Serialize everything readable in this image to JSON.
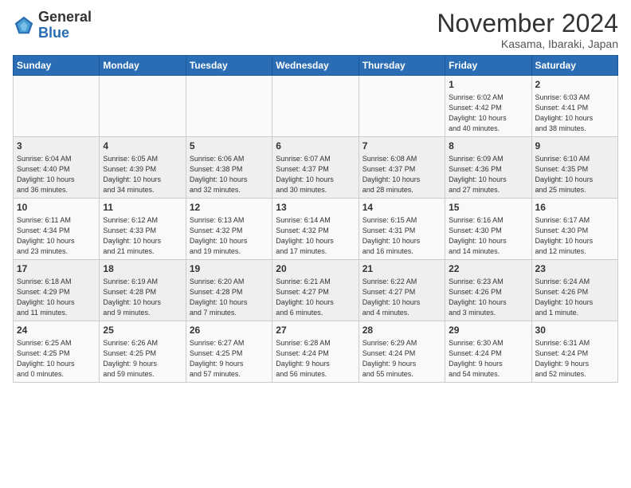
{
  "header": {
    "logo_general": "General",
    "logo_blue": "Blue",
    "month_title": "November 2024",
    "subtitle": "Kasama, Ibaraki, Japan"
  },
  "weekdays": [
    "Sunday",
    "Monday",
    "Tuesday",
    "Wednesday",
    "Thursday",
    "Friday",
    "Saturday"
  ],
  "weeks": [
    [
      {
        "day": "",
        "info": ""
      },
      {
        "day": "",
        "info": ""
      },
      {
        "day": "",
        "info": ""
      },
      {
        "day": "",
        "info": ""
      },
      {
        "day": "",
        "info": ""
      },
      {
        "day": "1",
        "info": "Sunrise: 6:02 AM\nSunset: 4:42 PM\nDaylight: 10 hours\nand 40 minutes."
      },
      {
        "day": "2",
        "info": "Sunrise: 6:03 AM\nSunset: 4:41 PM\nDaylight: 10 hours\nand 38 minutes."
      }
    ],
    [
      {
        "day": "3",
        "info": "Sunrise: 6:04 AM\nSunset: 4:40 PM\nDaylight: 10 hours\nand 36 minutes."
      },
      {
        "day": "4",
        "info": "Sunrise: 6:05 AM\nSunset: 4:39 PM\nDaylight: 10 hours\nand 34 minutes."
      },
      {
        "day": "5",
        "info": "Sunrise: 6:06 AM\nSunset: 4:38 PM\nDaylight: 10 hours\nand 32 minutes."
      },
      {
        "day": "6",
        "info": "Sunrise: 6:07 AM\nSunset: 4:37 PM\nDaylight: 10 hours\nand 30 minutes."
      },
      {
        "day": "7",
        "info": "Sunrise: 6:08 AM\nSunset: 4:37 PM\nDaylight: 10 hours\nand 28 minutes."
      },
      {
        "day": "8",
        "info": "Sunrise: 6:09 AM\nSunset: 4:36 PM\nDaylight: 10 hours\nand 27 minutes."
      },
      {
        "day": "9",
        "info": "Sunrise: 6:10 AM\nSunset: 4:35 PM\nDaylight: 10 hours\nand 25 minutes."
      }
    ],
    [
      {
        "day": "10",
        "info": "Sunrise: 6:11 AM\nSunset: 4:34 PM\nDaylight: 10 hours\nand 23 minutes."
      },
      {
        "day": "11",
        "info": "Sunrise: 6:12 AM\nSunset: 4:33 PM\nDaylight: 10 hours\nand 21 minutes."
      },
      {
        "day": "12",
        "info": "Sunrise: 6:13 AM\nSunset: 4:32 PM\nDaylight: 10 hours\nand 19 minutes."
      },
      {
        "day": "13",
        "info": "Sunrise: 6:14 AM\nSunset: 4:32 PM\nDaylight: 10 hours\nand 17 minutes."
      },
      {
        "day": "14",
        "info": "Sunrise: 6:15 AM\nSunset: 4:31 PM\nDaylight: 10 hours\nand 16 minutes."
      },
      {
        "day": "15",
        "info": "Sunrise: 6:16 AM\nSunset: 4:30 PM\nDaylight: 10 hours\nand 14 minutes."
      },
      {
        "day": "16",
        "info": "Sunrise: 6:17 AM\nSunset: 4:30 PM\nDaylight: 10 hours\nand 12 minutes."
      }
    ],
    [
      {
        "day": "17",
        "info": "Sunrise: 6:18 AM\nSunset: 4:29 PM\nDaylight: 10 hours\nand 11 minutes."
      },
      {
        "day": "18",
        "info": "Sunrise: 6:19 AM\nSunset: 4:28 PM\nDaylight: 10 hours\nand 9 minutes."
      },
      {
        "day": "19",
        "info": "Sunrise: 6:20 AM\nSunset: 4:28 PM\nDaylight: 10 hours\nand 7 minutes."
      },
      {
        "day": "20",
        "info": "Sunrise: 6:21 AM\nSunset: 4:27 PM\nDaylight: 10 hours\nand 6 minutes."
      },
      {
        "day": "21",
        "info": "Sunrise: 6:22 AM\nSunset: 4:27 PM\nDaylight: 10 hours\nand 4 minutes."
      },
      {
        "day": "22",
        "info": "Sunrise: 6:23 AM\nSunset: 4:26 PM\nDaylight: 10 hours\nand 3 minutes."
      },
      {
        "day": "23",
        "info": "Sunrise: 6:24 AM\nSunset: 4:26 PM\nDaylight: 10 hours\nand 1 minute."
      }
    ],
    [
      {
        "day": "24",
        "info": "Sunrise: 6:25 AM\nSunset: 4:25 PM\nDaylight: 10 hours\nand 0 minutes."
      },
      {
        "day": "25",
        "info": "Sunrise: 6:26 AM\nSunset: 4:25 PM\nDaylight: 9 hours\nand 59 minutes."
      },
      {
        "day": "26",
        "info": "Sunrise: 6:27 AM\nSunset: 4:25 PM\nDaylight: 9 hours\nand 57 minutes."
      },
      {
        "day": "27",
        "info": "Sunrise: 6:28 AM\nSunset: 4:24 PM\nDaylight: 9 hours\nand 56 minutes."
      },
      {
        "day": "28",
        "info": "Sunrise: 6:29 AM\nSunset: 4:24 PM\nDaylight: 9 hours\nand 55 minutes."
      },
      {
        "day": "29",
        "info": "Sunrise: 6:30 AM\nSunset: 4:24 PM\nDaylight: 9 hours\nand 54 minutes."
      },
      {
        "day": "30",
        "info": "Sunrise: 6:31 AM\nSunset: 4:24 PM\nDaylight: 9 hours\nand 52 minutes."
      }
    ]
  ]
}
